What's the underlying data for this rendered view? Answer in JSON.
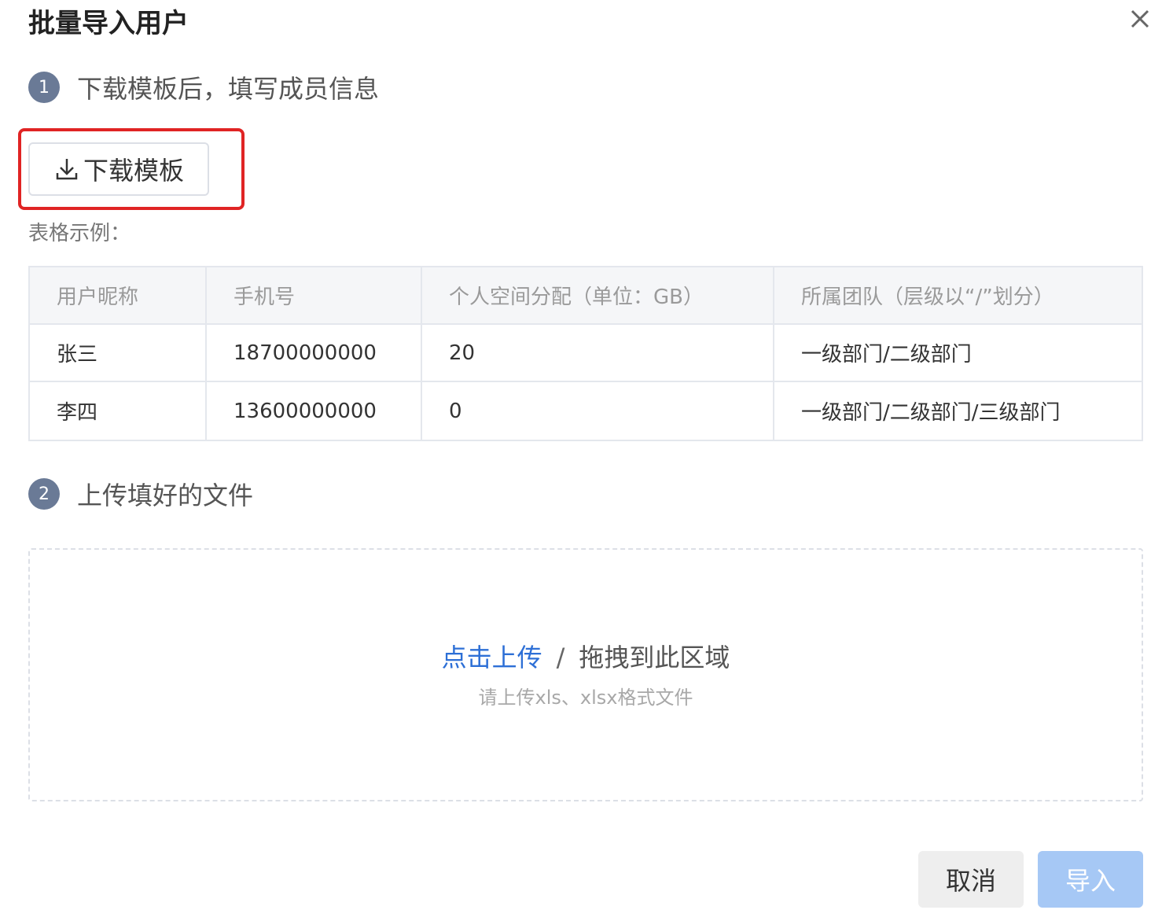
{
  "dialog": {
    "title": "批量导入用户"
  },
  "step1": {
    "number": "1",
    "text": "下载模板后，填写成员信息"
  },
  "download_button": {
    "label": "下载模板"
  },
  "example": {
    "label": "表格示例："
  },
  "table": {
    "headers": [
      "用户昵称",
      "手机号",
      "个人空间分配（单位：GB）",
      "所属团队（层级以“/”划分）"
    ],
    "rows": [
      [
        "张三",
        "18700000000",
        "20",
        "一级部门/二级部门"
      ],
      [
        "李四",
        "13600000000",
        "0",
        "一级部门/二级部门/三级部门"
      ]
    ]
  },
  "step2": {
    "number": "2",
    "text": "上传填好的文件"
  },
  "upload": {
    "link_text": "点击上传",
    "separator": "/",
    "drag_text": "拖拽到此区域",
    "hint": "请上传xls、xlsx格式文件"
  },
  "footer": {
    "cancel_label": "取消",
    "import_label": "导入"
  },
  "colors": {
    "highlight": "#e02424",
    "link": "#2d6fd6",
    "import_disabled": "#a6c8f5",
    "step_badge": "#6a7a96"
  }
}
